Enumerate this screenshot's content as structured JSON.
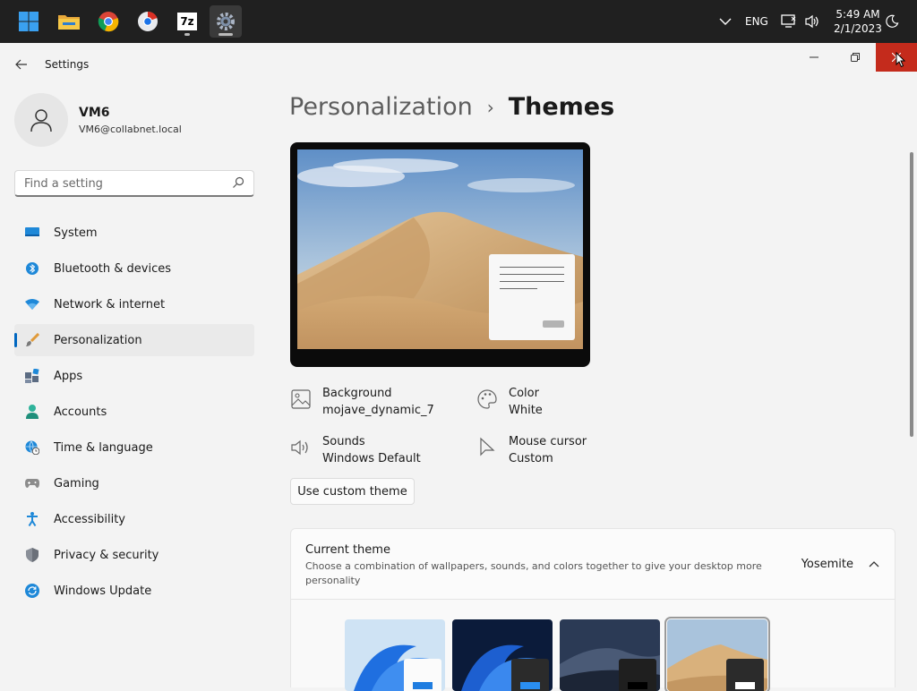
{
  "taskbar": {
    "icons": [
      "windows-start",
      "file-explorer",
      "chrome",
      "chrome-beta",
      "7zip",
      "settings"
    ],
    "sevenzip_label": "7z",
    "tray": {
      "language": "ENG",
      "time": "5:49 AM",
      "date": "2/1/2023"
    }
  },
  "window": {
    "app_title": "Settings"
  },
  "profile": {
    "name": "VM6",
    "email": "VM6@collabnet.local"
  },
  "search": {
    "placeholder": "Find a setting"
  },
  "nav": {
    "items": [
      {
        "label": "System",
        "icon": "system-icon"
      },
      {
        "label": "Bluetooth & devices",
        "icon": "bluetooth-icon"
      },
      {
        "label": "Network & internet",
        "icon": "network-icon"
      },
      {
        "label": "Personalization",
        "icon": "brush-icon",
        "selected": true
      },
      {
        "label": "Apps",
        "icon": "apps-icon"
      },
      {
        "label": "Accounts",
        "icon": "accounts-icon"
      },
      {
        "label": "Time & language",
        "icon": "globe-clock-icon"
      },
      {
        "label": "Gaming",
        "icon": "gamepad-icon"
      },
      {
        "label": "Accessibility",
        "icon": "accessibility-icon"
      },
      {
        "label": "Privacy & security",
        "icon": "shield-icon"
      },
      {
        "label": "Windows Update",
        "icon": "update-icon"
      }
    ]
  },
  "breadcrumb": {
    "parent": "Personalization",
    "separator": "›",
    "current": "Themes"
  },
  "properties": {
    "background": {
      "label": "Background",
      "value": "mojave_dynamic_7"
    },
    "color": {
      "label": "Color",
      "value": "White"
    },
    "sounds": {
      "label": "Sounds",
      "value": "Windows Default"
    },
    "mouse_cursor": {
      "label": "Mouse cursor",
      "value": "Custom"
    }
  },
  "custom_theme_button": "Use custom theme",
  "current_theme": {
    "title": "Current theme",
    "description": "Choose a combination of wallpapers, sounds, and colors together to give your desktop more personality",
    "value": "Yosemite"
  },
  "theme_thumbnails": [
    "windows-light",
    "windows-dark",
    "night-dunes",
    "mojave"
  ],
  "colors": {
    "accent": "#0067c0",
    "close": "#c42b1c",
    "taskbar": "#202020"
  }
}
